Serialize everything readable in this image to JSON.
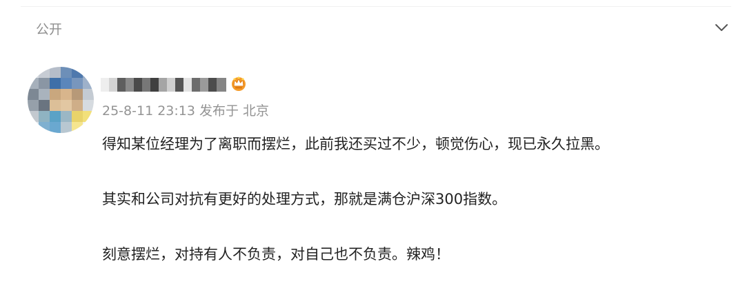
{
  "header": {
    "visibility_label": "公开"
  },
  "post": {
    "author": {
      "name_obscured": true
    },
    "meta": {
      "timestamp": "25-8-11 23:13",
      "published_from": "发布于 北京"
    },
    "paragraphs": [
      "得知某位经理为了离职而摆烂，此前我还买过不少，顿觉伤心，现已永久拉黑。",
      "其实和公司对抗有更好的处理方式，那就是满仓沪深300指数。",
      "刻意摆烂，对持有人不负责，对自己也不负责。辣鸡！"
    ]
  },
  "icons": {
    "expand": "chevron-down-icon",
    "badge": "vip-crown-badge-icon"
  },
  "colors": {
    "muted_text": "#939393",
    "body_text": "#222222",
    "badge_orange": "#f59b2a"
  }
}
